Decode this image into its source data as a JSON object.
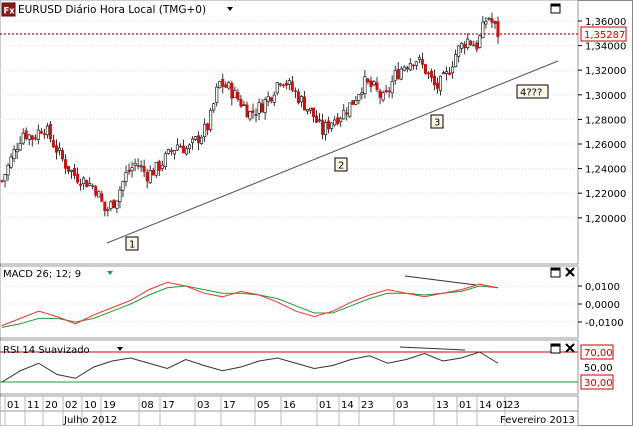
{
  "price_panel": {
    "symbol_icon_text": "Fx",
    "title": "EURUSD Diário Hora Local (TMG+0)",
    "current_price": "1,35287",
    "y_ticks": [
      "1,36000",
      "1,34000",
      "1,32000",
      "1,30000",
      "1,28000",
      "1,26000",
      "1,24000",
      "1,22000",
      "1,20000"
    ],
    "wave_labels": [
      "1",
      "2",
      "3",
      "4???"
    ]
  },
  "macd_panel": {
    "title": "MACD 26; 12; 9",
    "y_ticks": [
      "0,0100",
      "0,0000",
      "-0,0100"
    ]
  },
  "rsi_panel": {
    "title": "RSI 14 Suavizado",
    "level_high": "70,00",
    "value_label": "50,00",
    "level_low": "30,00"
  },
  "x_axis": {
    "ticks": [
      "01",
      "11",
      "20",
      "02",
      "10",
      "19",
      "08",
      "17",
      "03",
      "17",
      "05",
      "16",
      "01",
      "14",
      "23",
      "03",
      "13",
      "01",
      "14",
      "23",
      "01"
    ],
    "month_labels": [
      "Julho 2012",
      "Fevereiro 2013"
    ]
  },
  "colors": {
    "up_candle": "#000000",
    "down_candle": "#cc1111",
    "price_line": "#cc0000",
    "macd_line": "#ee3333",
    "signal_line": "#229933",
    "rsi_high": "#cc0000",
    "rsi_low": "#229933"
  },
  "chart_data": {
    "type": "candlestick",
    "title": "EURUSD Diário Hora Local (TMG+0)",
    "y_ticks": [
      1.36,
      1.34,
      1.32,
      1.3,
      1.28,
      1.26,
      1.24,
      1.22,
      1.2
    ],
    "current_price": 1.35287,
    "close_path": [
      1.23,
      1.25,
      1.27,
      1.265,
      1.275,
      1.26,
      1.245,
      1.235,
      1.23,
      1.225,
      1.205,
      1.215,
      1.235,
      1.245,
      1.235,
      1.24,
      1.25,
      1.26,
      1.255,
      1.265,
      1.275,
      1.31,
      1.305,
      1.295,
      1.285,
      1.29,
      1.3,
      1.315,
      1.305,
      1.295,
      1.285,
      1.27,
      1.28,
      1.285,
      1.295,
      1.31,
      1.305,
      1.295,
      1.315,
      1.325,
      1.33,
      1.32,
      1.305,
      1.315,
      1.335,
      1.345,
      1.34,
      1.365,
      1.35
    ],
    "trendline": {
      "from": [
        1.205,
        "19 Jul 2012"
      ],
      "to": [
        1.335,
        "Feb 2013"
      ]
    },
    "macd": [
      -0.012,
      -0.008,
      -0.004,
      -0.007,
      -0.011,
      -0.006,
      -0.002,
      0.002,
      0.008,
      0.012,
      0.01,
      0.006,
      0.004,
      0.007,
      0.005,
      0.001,
      -0.004,
      -0.007,
      -0.004,
      0.001,
      0.005,
      0.008,
      0.006,
      0.004,
      0.006,
      0.008,
      0.011,
      0.009
    ],
    "macd_signal": [
      -0.013,
      -0.011,
      -0.008,
      -0.008,
      -0.01,
      -0.008,
      -0.004,
      0.0,
      0.005,
      0.009,
      0.01,
      0.008,
      0.006,
      0.006,
      0.005,
      0.003,
      -0.001,
      -0.005,
      -0.005,
      -0.001,
      0.003,
      0.006,
      0.006,
      0.005,
      0.006,
      0.007,
      0.01,
      0.009
    ],
    "rsi": [
      30,
      45,
      55,
      40,
      35,
      50,
      58,
      62,
      55,
      48,
      60,
      52,
      45,
      50,
      58,
      62,
      55,
      48,
      52,
      60,
      65,
      55,
      60,
      68,
      58,
      62,
      70,
      55
    ],
    "rsi_levels": [
      70,
      30
    ]
  }
}
